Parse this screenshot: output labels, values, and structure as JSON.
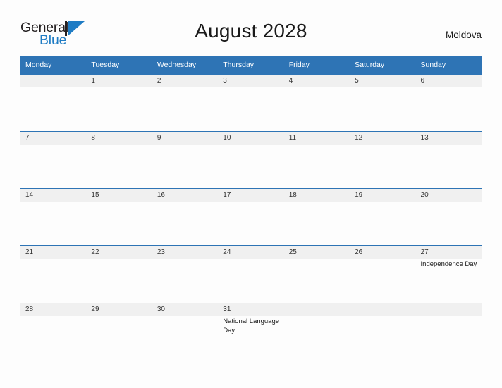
{
  "brand": {
    "name_part1": "General",
    "name_part2": "Blue",
    "logo_icon": "blue-triangle-flag-icon",
    "accent_color": "#1f7cc4",
    "text_color": "#231f20"
  },
  "header": {
    "title": "August 2028",
    "country": "Moldova"
  },
  "calendar": {
    "header_bg_color": "#2e74b5",
    "daynum_band_color": "#f0f0f0",
    "day_names": [
      "Monday",
      "Tuesday",
      "Wednesday",
      "Thursday",
      "Friday",
      "Saturday",
      "Sunday"
    ],
    "weeks": [
      [
        {
          "day": "",
          "event": ""
        },
        {
          "day": "1",
          "event": ""
        },
        {
          "day": "2",
          "event": ""
        },
        {
          "day": "3",
          "event": ""
        },
        {
          "day": "4",
          "event": ""
        },
        {
          "day": "5",
          "event": ""
        },
        {
          "day": "6",
          "event": ""
        }
      ],
      [
        {
          "day": "7",
          "event": ""
        },
        {
          "day": "8",
          "event": ""
        },
        {
          "day": "9",
          "event": ""
        },
        {
          "day": "10",
          "event": ""
        },
        {
          "day": "11",
          "event": ""
        },
        {
          "day": "12",
          "event": ""
        },
        {
          "day": "13",
          "event": ""
        }
      ],
      [
        {
          "day": "14",
          "event": ""
        },
        {
          "day": "15",
          "event": ""
        },
        {
          "day": "16",
          "event": ""
        },
        {
          "day": "17",
          "event": ""
        },
        {
          "day": "18",
          "event": ""
        },
        {
          "day": "19",
          "event": ""
        },
        {
          "day": "20",
          "event": ""
        }
      ],
      [
        {
          "day": "21",
          "event": ""
        },
        {
          "day": "22",
          "event": ""
        },
        {
          "day": "23",
          "event": ""
        },
        {
          "day": "24",
          "event": ""
        },
        {
          "day": "25",
          "event": ""
        },
        {
          "day": "26",
          "event": ""
        },
        {
          "day": "27",
          "event": "Independence Day"
        }
      ],
      [
        {
          "day": "28",
          "event": ""
        },
        {
          "day": "29",
          "event": ""
        },
        {
          "day": "30",
          "event": ""
        },
        {
          "day": "31",
          "event": "National Language Day"
        },
        {
          "day": "",
          "event": ""
        },
        {
          "day": "",
          "event": ""
        },
        {
          "day": "",
          "event": ""
        }
      ]
    ]
  }
}
